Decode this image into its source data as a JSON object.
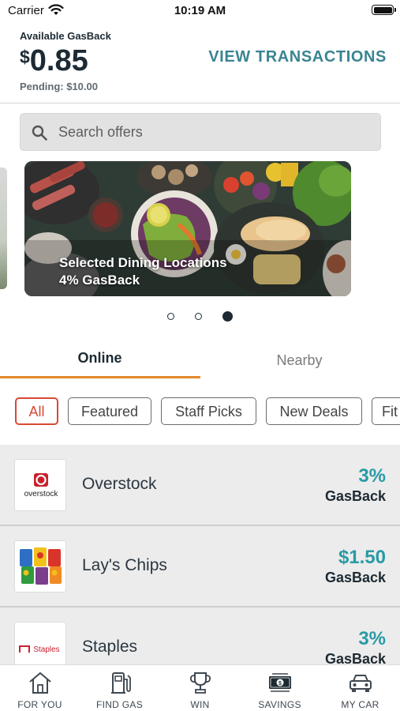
{
  "status_bar": {
    "carrier": "Carrier",
    "time": "10:19 AM"
  },
  "balance": {
    "label": "Available GasBack",
    "currency_symbol": "$",
    "amount": "0.85",
    "pending": "Pending: $10.00",
    "view_transactions": "VIEW TRANSACTIONS"
  },
  "search": {
    "placeholder": "Search offers"
  },
  "carousel": {
    "title": "Selected Dining Locations",
    "subtitle": "4% GasBack",
    "page_count": 3,
    "active_index": 2
  },
  "tabs": {
    "online": "Online",
    "nearby": "Nearby",
    "active": "online"
  },
  "filters": [
    "All",
    "Featured",
    "Staff Picks",
    "New Deals",
    "Fit"
  ],
  "offers": [
    {
      "name": "Overstock",
      "rate": "3%",
      "unit": "GasBack",
      "logo_text": "overstock"
    },
    {
      "name": "Lay's Chips",
      "rate": "$1.50",
      "unit": "GasBack",
      "logo_text": ""
    },
    {
      "name": "Staples",
      "rate": "3%",
      "unit": "GasBack",
      "logo_text": "Staples"
    }
  ],
  "bottom_nav": [
    {
      "label": "FOR YOU",
      "icon": "home-icon"
    },
    {
      "label": "FIND GAS",
      "icon": "gas-pump-icon"
    },
    {
      "label": "WIN",
      "icon": "trophy-icon"
    },
    {
      "label": "SAVINGS",
      "icon": "dollar-bill-icon"
    },
    {
      "label": "MY CAR",
      "icon": "car-icon"
    }
  ],
  "colors": {
    "accent_teal": "#3a8492",
    "rate_teal": "#2a9aa6",
    "tab_underline": "#e48a2b",
    "chip_active": "#d84a35",
    "text_dark": "#1d2a33"
  }
}
